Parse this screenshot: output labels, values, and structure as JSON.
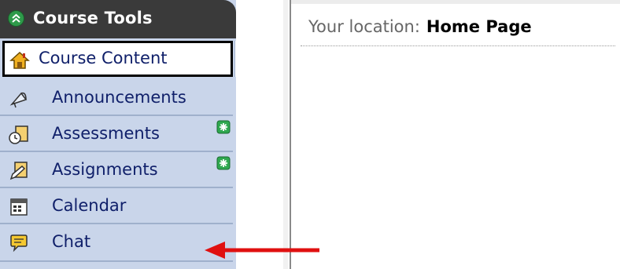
{
  "sidebar": {
    "header": {
      "title": "Course Tools",
      "collapse_icon": "double-chevron-up-icon"
    },
    "selected": {
      "label": "Course Content",
      "icon": "house-icon",
      "expand_icon": "double-chevron-down-icon"
    },
    "items": [
      {
        "label": "Announcements",
        "icon": "megaphone-icon",
        "new": false
      },
      {
        "label": "Assessments",
        "icon": "clipboard-clock-icon",
        "new": true
      },
      {
        "label": "Assignments",
        "icon": "paper-pencil-icon",
        "new": true
      },
      {
        "label": "Calendar",
        "icon": "calendar-icon",
        "new": false
      },
      {
        "label": "Chat",
        "icon": "speech-bubble-icon",
        "new": false
      }
    ]
  },
  "content": {
    "breadcrumb_prefix": "Your location:",
    "breadcrumb_current": "Home Page"
  },
  "colors": {
    "header_bg": "#3a3a3a",
    "row_bg": "#c9d5ea",
    "label_text": "#10206a",
    "new_badge": "#2fa84f",
    "annotation_arrow": "#e01010"
  }
}
